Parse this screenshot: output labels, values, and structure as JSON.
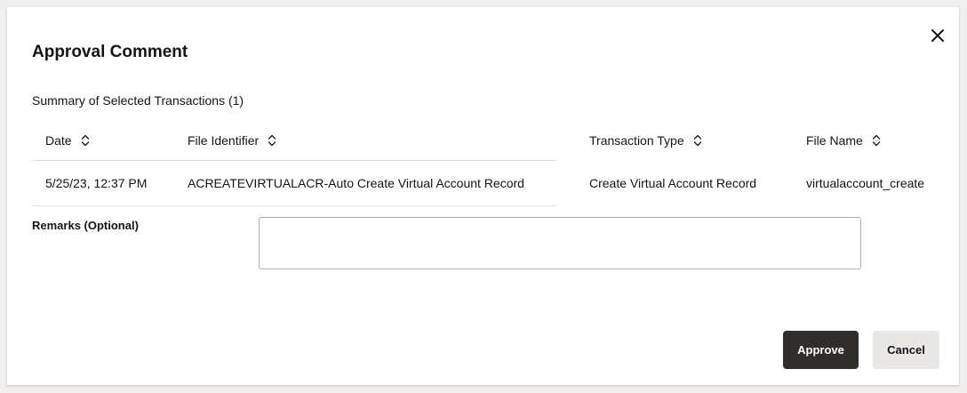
{
  "dialog": {
    "title": "Approval Comment",
    "close_icon": "close-icon",
    "summary_label": "Summary of Selected Transactions (1)"
  },
  "table": {
    "columns": [
      {
        "label": "Date",
        "sort_icon": "sort-icon"
      },
      {
        "label": "File Identifier",
        "sort_icon": "sort-icon"
      },
      {
        "label": "Transaction Type",
        "sort_icon": "sort-icon"
      },
      {
        "label": "File Name",
        "sort_icon": "sort-icon"
      }
    ],
    "rows": [
      {
        "date": "5/25/23, 12:37 PM",
        "file_identifier": "ACREATEVIRTUALACR-Auto Create Virtual Account Record",
        "transaction_type": "Create Virtual Account Record",
        "file_name": "virtualaccount_create"
      }
    ]
  },
  "remarks": {
    "label": "Remarks (Optional)",
    "value": "",
    "placeholder": ""
  },
  "buttons": {
    "approve_label": "Approve",
    "cancel_label": "Cancel"
  },
  "colors": {
    "primary_button": "#312d2a",
    "secondary_button": "#e9e7e4",
    "text": "#161513"
  }
}
